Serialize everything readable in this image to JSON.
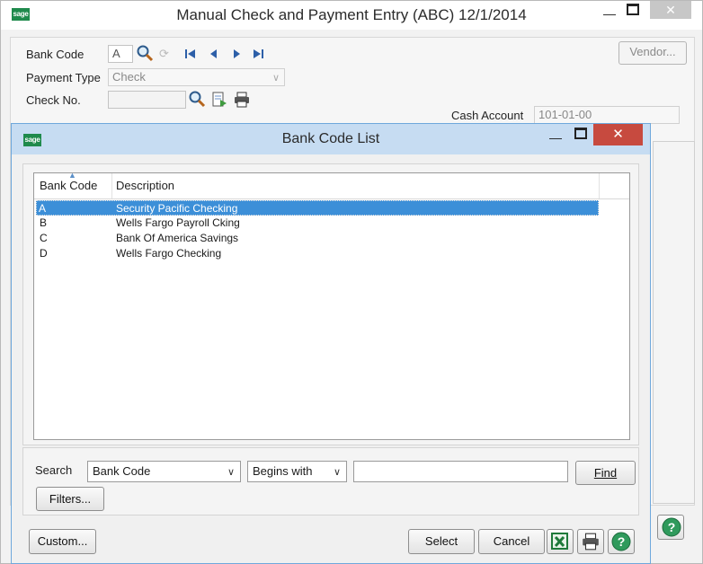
{
  "main": {
    "logo": "sage",
    "title": "Manual Check and Payment Entry (ABC) 12/1/2014",
    "labels": {
      "bank_code": "Bank Code",
      "payment_type": "Payment Type",
      "check_no": "Check No.",
      "cash_account": "Cash Account"
    },
    "bank_code_value": "A",
    "payment_type_value": "Check",
    "cash_account_value": "101-01-00",
    "vendor_button": "Vendor..."
  },
  "dialog": {
    "logo": "sage",
    "title": "Bank Code List",
    "columns": [
      "Bank Code",
      "Description"
    ],
    "rows": [
      {
        "code": "A",
        "description": "Security Pacific Checking"
      },
      {
        "code": "B",
        "description": "Wells Fargo Payroll Cking"
      },
      {
        "code": "C",
        "description": "Bank Of America Savings"
      },
      {
        "code": "D",
        "description": "Wells Fargo Checking"
      }
    ],
    "search_label": "Search",
    "search_field": "Bank Code",
    "search_mode": "Begins with",
    "find_button": "Find",
    "filters_button": "Filters...",
    "custom_button": "Custom...",
    "select_button": "Select",
    "cancel_button": "Cancel"
  },
  "icons": {
    "minimize": "minimize-icon",
    "maximize": "maximize-icon",
    "close": "close-icon",
    "lookup": "magnifier-icon",
    "first": "first-record-icon",
    "prev": "previous-record-icon",
    "next": "next-record-icon",
    "last": "last-record-icon",
    "print": "printer-icon",
    "excel": "excel-export-icon",
    "help": "help-icon"
  },
  "colors": {
    "selection": "#3c8fd8",
    "dialog_title": "#c6dcf2",
    "close_red": "#c74a3f",
    "sage_green": "#1f8a4c"
  }
}
